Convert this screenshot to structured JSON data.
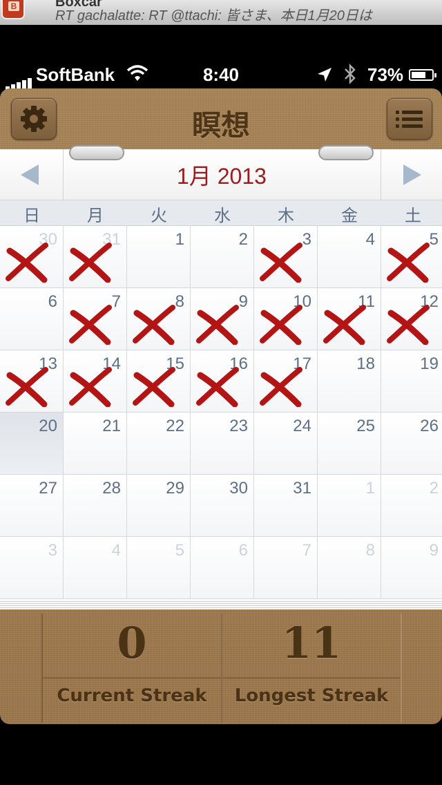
{
  "notification": {
    "app_name": "Boxcar",
    "message": "RT gachalatte: RT @ttachi: 皆さま、本日1月20日は"
  },
  "status_bar": {
    "carrier": "SoftBank",
    "time": "8:40",
    "battery_percent": "73%",
    "battery_level": 0.73
  },
  "app": {
    "title": "瞑想",
    "settings_icon": "gear-icon",
    "menu_icon": "list-icon"
  },
  "calendar": {
    "month_label": "1月 2013",
    "weekdays": [
      "日",
      "月",
      "火",
      "水",
      "木",
      "金",
      "土"
    ],
    "marked_color": "#b31414",
    "weeks": [
      [
        {
          "day": "30",
          "other": true,
          "marked": true
        },
        {
          "day": "31",
          "other": true,
          "marked": true
        },
        {
          "day": "1",
          "other": false,
          "marked": false
        },
        {
          "day": "2",
          "other": false,
          "marked": false
        },
        {
          "day": "3",
          "other": false,
          "marked": true
        },
        {
          "day": "4",
          "other": false,
          "marked": false
        },
        {
          "day": "5",
          "other": false,
          "marked": true
        }
      ],
      [
        {
          "day": "6",
          "other": false,
          "marked": false
        },
        {
          "day": "7",
          "other": false,
          "marked": true
        },
        {
          "day": "8",
          "other": false,
          "marked": true
        },
        {
          "day": "9",
          "other": false,
          "marked": true
        },
        {
          "day": "10",
          "other": false,
          "marked": true
        },
        {
          "day": "11",
          "other": false,
          "marked": true
        },
        {
          "day": "12",
          "other": false,
          "marked": true
        }
      ],
      [
        {
          "day": "13",
          "other": false,
          "marked": true
        },
        {
          "day": "14",
          "other": false,
          "marked": true
        },
        {
          "day": "15",
          "other": false,
          "marked": true
        },
        {
          "day": "16",
          "other": false,
          "marked": true
        },
        {
          "day": "17",
          "other": false,
          "marked": true
        },
        {
          "day": "18",
          "other": false,
          "marked": false
        },
        {
          "day": "19",
          "other": false,
          "marked": false
        }
      ],
      [
        {
          "day": "20",
          "other": false,
          "marked": false,
          "today": true
        },
        {
          "day": "21",
          "other": false,
          "marked": false
        },
        {
          "day": "22",
          "other": false,
          "marked": false
        },
        {
          "day": "23",
          "other": false,
          "marked": false
        },
        {
          "day": "24",
          "other": false,
          "marked": false
        },
        {
          "day": "25",
          "other": false,
          "marked": false
        },
        {
          "day": "26",
          "other": false,
          "marked": false
        }
      ],
      [
        {
          "day": "27",
          "other": false,
          "marked": false
        },
        {
          "day": "28",
          "other": false,
          "marked": false
        },
        {
          "day": "29",
          "other": false,
          "marked": false
        },
        {
          "day": "30",
          "other": false,
          "marked": false
        },
        {
          "day": "31",
          "other": false,
          "marked": false
        },
        {
          "day": "1",
          "other": true,
          "marked": false
        },
        {
          "day": "2",
          "other": true,
          "marked": false
        }
      ],
      [
        {
          "day": "3",
          "other": true,
          "marked": false
        },
        {
          "day": "4",
          "other": true,
          "marked": false
        },
        {
          "day": "5",
          "other": true,
          "marked": false
        },
        {
          "day": "6",
          "other": true,
          "marked": false
        },
        {
          "day": "7",
          "other": true,
          "marked": false
        },
        {
          "day": "8",
          "other": true,
          "marked": false
        },
        {
          "day": "9",
          "other": true,
          "marked": false
        }
      ]
    ]
  },
  "stats": {
    "current_streak": {
      "value": "0",
      "label": "Current Streak"
    },
    "longest_streak": {
      "value": "11",
      "label": "Longest Streak"
    }
  }
}
